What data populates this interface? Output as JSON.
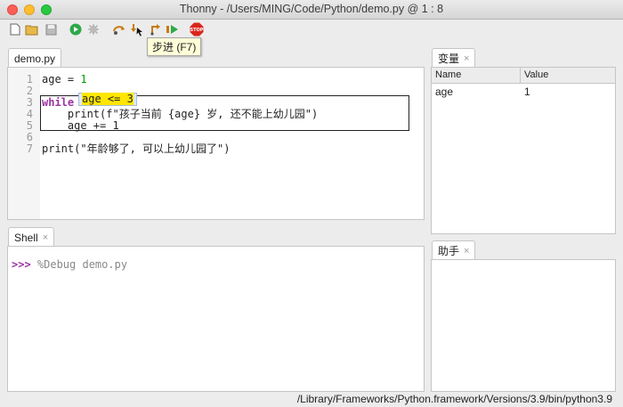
{
  "window": {
    "title": "Thonny  -  /Users/MING/Code/Python/demo.py  @  1 : 8"
  },
  "toolbar": {
    "buttons": [
      {
        "name": "new-file-icon",
        "glyph": "🗋"
      },
      {
        "name": "open-folder-icon",
        "glyph": "📂"
      },
      {
        "name": "save-icon",
        "glyph": "💾"
      },
      {
        "name": "run-icon",
        "glyph": "▶"
      },
      {
        "name": "debug-icon",
        "glyph": "✲"
      },
      {
        "name": "step-over-icon",
        "glyph": "↷"
      },
      {
        "name": "step-into-icon",
        "glyph": "↘"
      },
      {
        "name": "step-out-icon",
        "glyph": "↗"
      },
      {
        "name": "resume-icon",
        "glyph": "▷"
      },
      {
        "name": "stop-icon",
        "glyph": "STOP"
      }
    ],
    "tooltip": "步进 (F7)"
  },
  "editor": {
    "tab_label": "demo.py",
    "tab_close": "×",
    "line_numbers": [
      "1",
      "2",
      "3",
      "4",
      "5",
      "6",
      "7"
    ],
    "lines": {
      "l1_name": "age",
      "l1_op": " = ",
      "l1_val": "1",
      "l3_kw": "while",
      "l4_text": "    print(f\"孩子当前 {age} 岁, 还不能上幼儿园\")",
      "l5_text": "    age += 1",
      "l7_text": "print(\"年龄够了, 可以上幼儿园了\")"
    },
    "eval_expr": "age <= 3"
  },
  "variables": {
    "tab_label": "变量",
    "tab_close": "×",
    "columns": [
      "Name",
      "Value"
    ],
    "rows": [
      {
        "name": "age",
        "value": "1"
      }
    ]
  },
  "shell": {
    "tab_label": "Shell",
    "tab_close": "×",
    "prompt": ">>>",
    "command": " %Debug demo.py"
  },
  "assistant": {
    "tab_label": "助手",
    "tab_close": "×"
  },
  "status": {
    "interpreter": "/Library/Frameworks/Python.framework/Versions/3.9/bin/python3.9"
  },
  "colors": {
    "keyword": "#9e31a3",
    "number": "#00a000",
    "string": "#1f7a1f",
    "highlight": "#ffe600"
  }
}
